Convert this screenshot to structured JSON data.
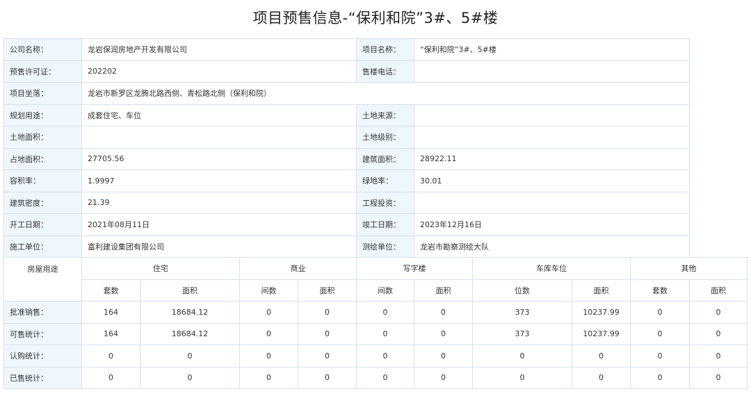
{
  "title": "项目预售信息-“保利和院”3#、5#楼",
  "info": {
    "company": {
      "label": "公司名称：",
      "value": "龙岩保润房地产开发有限公司"
    },
    "project_name": {
      "label": "项目名称：",
      "value": "“保利和院”3#、5#楼"
    },
    "permit": {
      "label": "预售许可证：",
      "value": "202202"
    },
    "sales_phone": {
      "label": "售楼电话：",
      "value": ""
    },
    "location": {
      "label": "项目坐落：",
      "value": "龙岩市新罗区龙腾北路西侧、青松路北侧（保利和院）"
    },
    "usage": {
      "label": "规划用途：",
      "value": "成套住宅、车位"
    },
    "land_source": {
      "label": "土地来源：",
      "value": ""
    },
    "land_area": {
      "label": "土地面积：",
      "value": ""
    },
    "land_grade": {
      "label": "土地级别：",
      "value": ""
    },
    "occupied_area": {
      "label": "占地面积：",
      "value": "27705.56"
    },
    "building_area": {
      "label": "建筑面积：",
      "value": "28922.11"
    },
    "plot_ratio": {
      "label": "容积率：",
      "value": "1.9997"
    },
    "green_ratio": {
      "label": "绿地率：",
      "value": "30.01"
    },
    "building_density": {
      "label": "建筑密度：",
      "value": "21.39"
    },
    "investment": {
      "label": "工程投资：",
      "value": ""
    },
    "start_date": {
      "label": "开工日期：",
      "value": "2021年08月11日"
    },
    "completion_date": {
      "label": "竣工日期：",
      "value": "2023年12月16日"
    },
    "contractor": {
      "label": "施工单位：",
      "value": "富利建设集团有限公司"
    },
    "surveyor": {
      "label": "测绘单位：",
      "value": "龙岩市勘察测绘大队"
    }
  },
  "stats": {
    "usage_header": "房屋用途",
    "groups": [
      "住宅",
      "商业",
      "写字楼",
      "车库车位",
      "其他"
    ],
    "subheaders": [
      "套数",
      "面积",
      "间数",
      "面积",
      "间数",
      "面积",
      "位数",
      "面积",
      "套数",
      "面积"
    ],
    "rows": [
      {
        "label": "批准销售：",
        "values": [
          "164",
          "18684.12",
          "0",
          "0",
          "0",
          "0",
          "373",
          "10237.99",
          "0",
          "0"
        ]
      },
      {
        "label": "可售统计：",
        "values": [
          "164",
          "18684.12",
          "0",
          "0",
          "0",
          "0",
          "373",
          "10237.99",
          "0",
          "0"
        ]
      },
      {
        "label": "认购统计：",
        "values": [
          "0",
          "0",
          "0",
          "0",
          "0",
          "0",
          "0",
          "0",
          "0",
          "0"
        ]
      },
      {
        "label": "已售统计：",
        "values": [
          "0",
          "0",
          "0",
          "0",
          "0",
          "0",
          "0",
          "0",
          "0",
          "0"
        ]
      }
    ]
  }
}
